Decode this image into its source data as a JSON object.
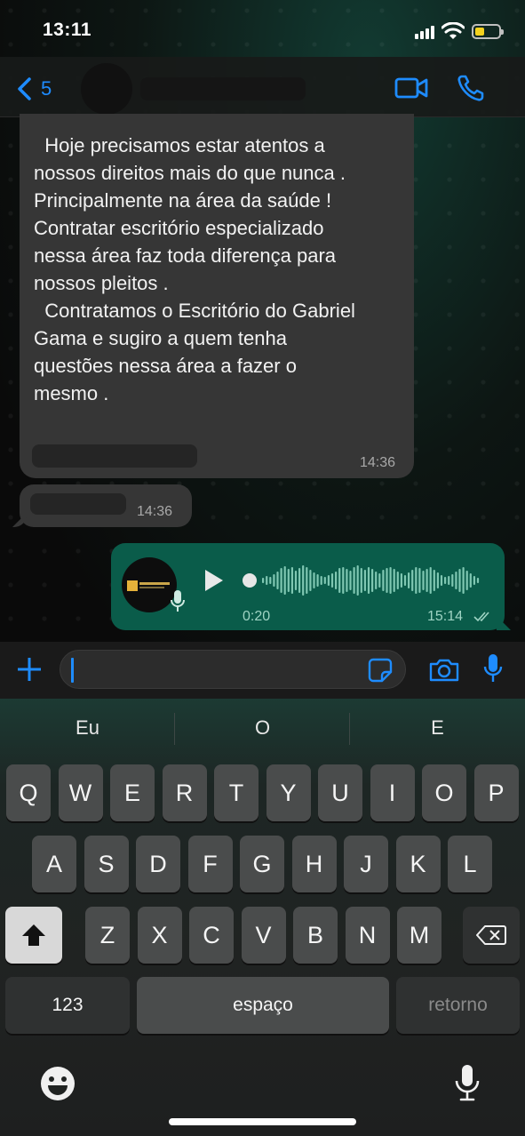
{
  "status_bar": {
    "time": "13:11"
  },
  "header": {
    "back_count": "5"
  },
  "messages": {
    "incoming_text": "  Hoje precisamos estar atentos a\nnossos direitos mais do que nunca .\nPrincipalmente na área da saúde !\nContratar escritório especializado\nnessa área faz toda diferença para\nnossos pleitos .\n  Contratamos o Escritório do Gabriel\nGama e sugiro a quem tenha\nquestões nessa área a fazer o\nmesmo .",
    "incoming_time": "14:36",
    "incoming_small_time": "14:36",
    "voice": {
      "duration": "0:20",
      "time": "15:14",
      "status": "read"
    }
  },
  "suggestions": [
    "Eu",
    "O",
    "E"
  ],
  "keyboard": {
    "row1": [
      "Q",
      "W",
      "E",
      "R",
      "T",
      "Y",
      "U",
      "I",
      "O",
      "P"
    ],
    "row2": [
      "A",
      "S",
      "D",
      "F",
      "G",
      "H",
      "J",
      "K",
      "L"
    ],
    "row3": [
      "Z",
      "X",
      "C",
      "V",
      "B",
      "N",
      "M"
    ],
    "numbers_label": "123",
    "space_label": "espaço",
    "return_label": "retorno"
  },
  "colors": {
    "accent": "#1e8cff",
    "outgoing_bubble": "#0a5c4a",
    "incoming_bubble": "#363636",
    "battery": "#f4d21e"
  }
}
